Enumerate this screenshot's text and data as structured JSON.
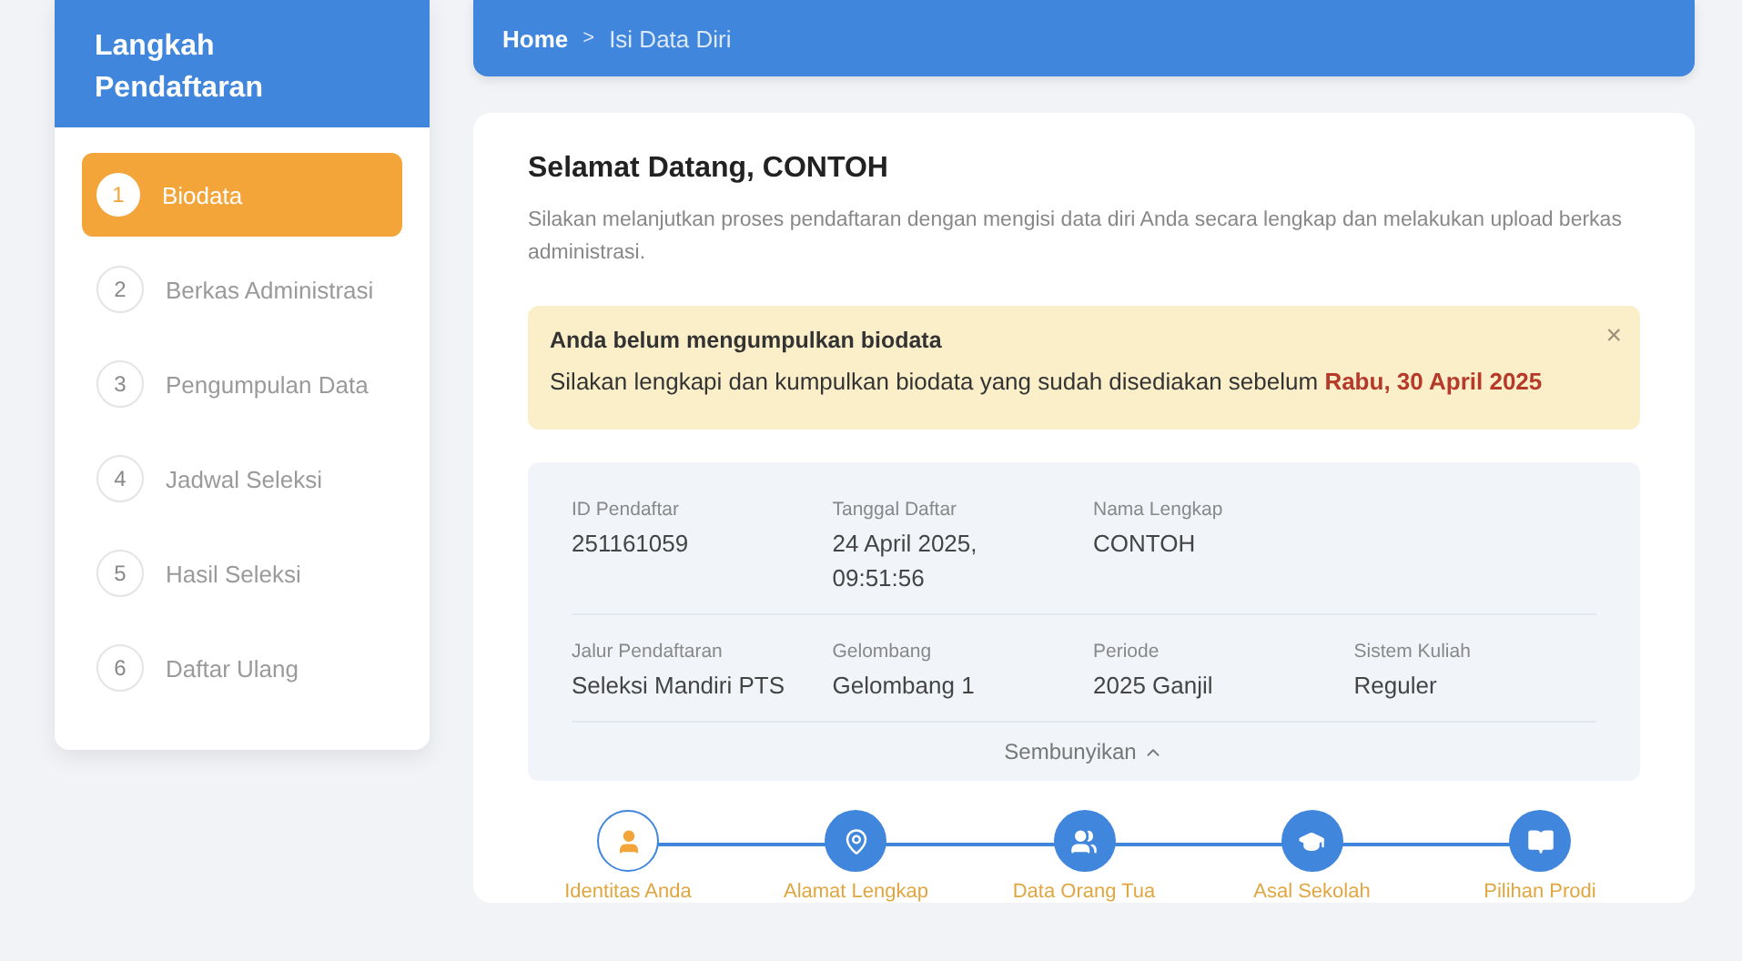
{
  "sidebar": {
    "title": "Langkah Pendaftaran",
    "steps": [
      {
        "number": "1",
        "label": "Biodata",
        "selected": true
      },
      {
        "number": "2",
        "label": "Berkas Administrasi",
        "selected": false
      },
      {
        "number": "3",
        "label": "Pengumpulan Data",
        "selected": false
      },
      {
        "number": "4",
        "label": "Jadwal Seleksi",
        "selected": false
      },
      {
        "number": "5",
        "label": "Hasil Seleksi",
        "selected": false
      },
      {
        "number": "6",
        "label": "Daftar Ulang",
        "selected": false
      }
    ]
  },
  "breadcrumb": {
    "home": "Home",
    "separator": ">",
    "current": "Isi Data Diri"
  },
  "welcome": {
    "title": "Selamat Datang, CONTOH",
    "text": "Silakan melanjutkan proses pendaftaran dengan mengisi data diri Anda secara lengkap dan melakukan upload berkas administrasi."
  },
  "alert": {
    "title": "Anda belum mengumpulkan biodata",
    "text": "Silakan lengkapi dan kumpulkan biodata yang sudah disediakan sebelum **Rabu, 30 April 2025**",
    "close": "×"
  },
  "info": {
    "rows": [
      [
        {
          "label": "ID Pendaftar",
          "value": "251161059"
        },
        {
          "label": "Tanggal Daftar",
          "value": "24 April 2025, 09:51:56"
        },
        {
          "label": "Nama Lengkap",
          "value": "CONTOH"
        }
      ],
      [
        {
          "label": "Jalur Pendaftaran",
          "value": "Seleksi Mandiri PTS"
        },
        {
          "label": "Gelombang",
          "value": "Gelombang 1"
        },
        {
          "label": "Periode",
          "value": "2025 Ganjil"
        },
        {
          "label": "Sistem Kuliah",
          "value": "Reguler"
        }
      ]
    ],
    "toggle": "Sembunyikan",
    "expanded": true
  },
  "progress": [
    {
      "label": "Identitas Anda",
      "kind": "user",
      "selected": true
    },
    {
      "label": "Alamat Lengkap",
      "kind": "pin",
      "selected": false
    },
    {
      "label": "Data Orang Tua",
      "kind": "group",
      "selected": false
    },
    {
      "label": "Asal Sekolah",
      "kind": "cap",
      "selected": false
    },
    {
      "label": "Pilihan Prodi",
      "kind": "book",
      "selected": false
    }
  ]
}
